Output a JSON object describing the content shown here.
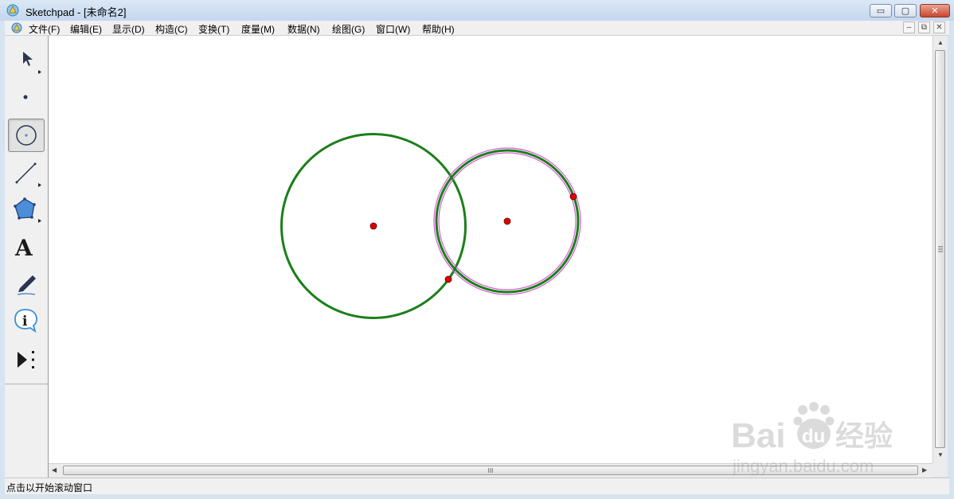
{
  "window": {
    "title": "Sketchpad  - [未命名2]",
    "controls": {
      "minimize": "▭",
      "maximize": "▢",
      "close": "✕"
    },
    "mdi_controls": {
      "minimize": "–",
      "restore": "⧉",
      "close": "✕"
    }
  },
  "menu": {
    "items": [
      {
        "label": "文件(F)"
      },
      {
        "label": "编辑(E)"
      },
      {
        "label": "显示(D)"
      },
      {
        "label": "构造(C)"
      },
      {
        "label": "变换(T)"
      },
      {
        "label": "度量(M)"
      },
      {
        "label": "数据(N)"
      },
      {
        "label": "绘图(G)"
      },
      {
        "label": "窗口(W)"
      },
      {
        "label": "帮助(H)"
      }
    ]
  },
  "toolbox": {
    "tools": [
      {
        "name": "arrow-select-tool",
        "selected": false
      },
      {
        "name": "point-tool",
        "selected": false
      },
      {
        "name": "compass-tool",
        "selected": true
      },
      {
        "name": "straightedge-tool",
        "selected": false
      },
      {
        "name": "polygon-tool",
        "selected": false
      },
      {
        "name": "text-tool",
        "selected": false,
        "glyph": "A"
      },
      {
        "name": "marker-tool",
        "selected": false
      },
      {
        "name": "information-tool",
        "selected": false,
        "glyph": "i"
      },
      {
        "name": "custom-tool",
        "selected": false
      }
    ]
  },
  "sketch": {
    "colors": {
      "circle": "#1a7f1a",
      "highlight": "#d85ad8",
      "point": "#e00000"
    }
  },
  "scrollbars": {
    "hthumb_grip": "III"
  },
  "status": {
    "text": "点击以开始滚动窗口"
  },
  "watermark": {
    "brand": "Bai",
    "brand2": "du",
    "cn": "经验",
    "url": "jingyan.baidu.com"
  }
}
